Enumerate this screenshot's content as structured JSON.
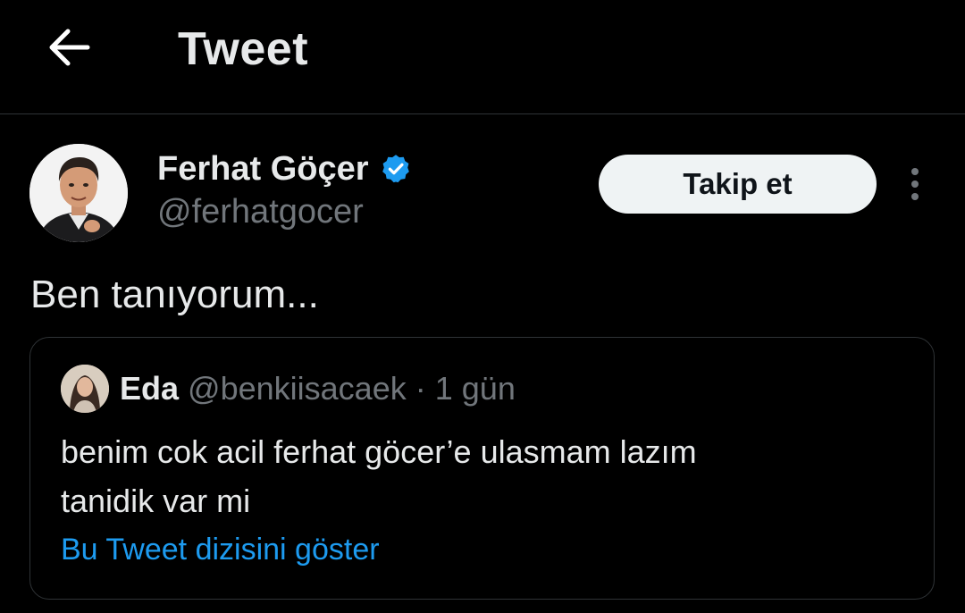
{
  "header": {
    "title": "Tweet",
    "back_icon": "arrow-left-icon"
  },
  "tweet": {
    "author": {
      "name": "Ferhat Göçer",
      "handle": "@ferhatgocer",
      "verified_icon": "verified-badge-icon",
      "verified_color": "#1d9bf0"
    },
    "follow_label": "Takip et",
    "more_icon": "more-vertical-icon",
    "text": "Ben tanıyorum..."
  },
  "quoted": {
    "author_name": "Eda",
    "author_handle": "@benkiisacaek",
    "separator": "·",
    "time": "1 gün",
    "text_lines": [
      "benim cok acil ferhat göcer’e ulasmam lazım",
      "tanidik var mi"
    ],
    "show_thread_label": "Bu Tweet dizisini göster"
  },
  "colors": {
    "background": "#000000",
    "text_primary": "#e7e9ea",
    "text_secondary": "#71767b",
    "accent": "#1d9bf0",
    "border": "#2f3336",
    "follow_button_bg": "#eff3f4"
  }
}
